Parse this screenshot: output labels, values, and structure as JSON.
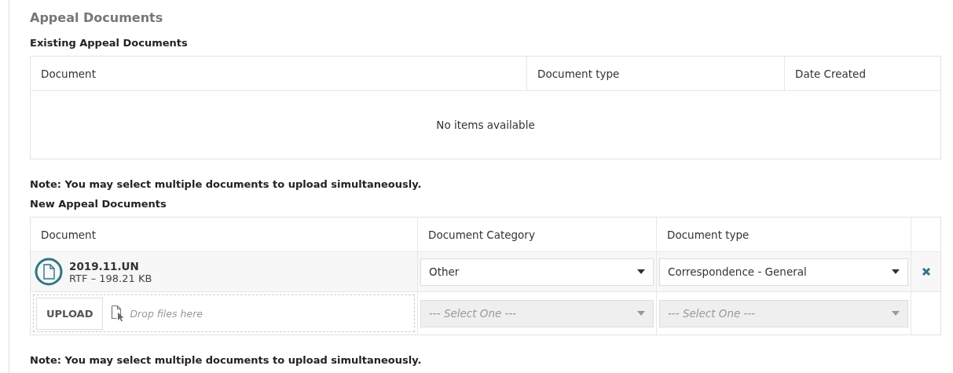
{
  "title": "Appeal Documents",
  "existing": {
    "heading": "Existing Appeal Documents",
    "columns": [
      "Document",
      "Document type",
      "Date Created"
    ],
    "empty_text": "No items available"
  },
  "note_1": "Note: You may select multiple documents to upload simultaneously.",
  "new_docs": {
    "heading": "New Appeal Documents",
    "columns": [
      "Document",
      "Document Category",
      "Document type"
    ],
    "rows": [
      {
        "kind": "file",
        "name": "2019.11.UN",
        "info": "RTF – 198.21 KB",
        "category": {
          "value": "Other",
          "disabled": false
        },
        "type": {
          "value": "Correspondence - General",
          "disabled": false
        }
      },
      {
        "kind": "upload",
        "button": "UPLOAD",
        "drop_text": "Drop files here",
        "category": {
          "placeholder": "--- Select One ---",
          "disabled": true
        },
        "type": {
          "placeholder": "--- Select One ---",
          "disabled": true
        }
      }
    ]
  },
  "note_2": "Note: You may select multiple documents to upload simultaneously."
}
